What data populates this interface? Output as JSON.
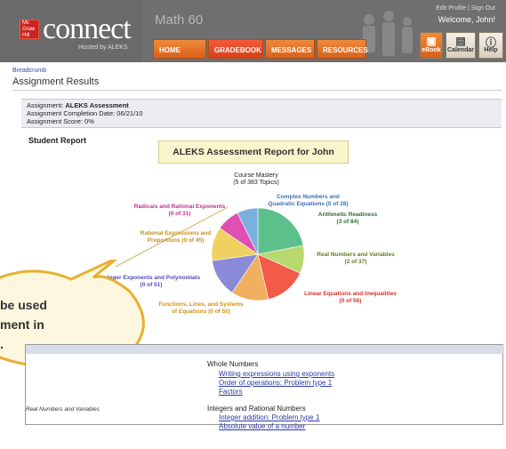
{
  "header": {
    "logo_text": "connect",
    "logo_sub": "Hosted by ALEKS",
    "mh_badge": [
      "Mc",
      "Graw",
      "Hill"
    ],
    "course": "Math 60",
    "top_links": "Edit Profile | Sign Out",
    "welcome": "Welcome, John!",
    "tabs": [
      {
        "label": "HOME"
      },
      {
        "label": "GRADEBOOK"
      },
      {
        "label": "MESSAGES"
      },
      {
        "label": "RESOURCES"
      }
    ],
    "tools": [
      {
        "label": "eBook",
        "icon": "book-icon"
      },
      {
        "label": "Calendar",
        "icon": "calendar-icon"
      },
      {
        "label": "Help",
        "icon": "help-icon"
      }
    ]
  },
  "breadcrumb": "Breadcrumb",
  "page_title": "Assignment Results",
  "assignment": {
    "label": "Assignment:",
    "name": "ALEKS Assessment",
    "completion": "Assignment Completion Date: 06/21/10",
    "score": "Assignment Score: 0%"
  },
  "student_report": "Student Report",
  "report_title": "ALEKS Assessment Report for John",
  "mastery": {
    "line1": "Course Mastery",
    "line2": "(5 of 383 Topics)"
  },
  "chart_data": {
    "type": "pie",
    "title": "Course Mastery",
    "subtitle": "(5 of 383 Topics)",
    "categories": [
      "Arithmetic Readiness",
      "Real Numbers and Variables",
      "Linear Equations and Inequalities",
      "Functions, Lines, and Systems of Equations",
      "Integer Exponents and Polynomials",
      "Rational Expressions and Proportions",
      "Radicals and Rational Exponents",
      "Complex Numbers and Quadratic Equations"
    ],
    "labels": [
      [
        "Arithmetic Readiness",
        "(3 of 84)"
      ],
      [
        "Real Numbers and Variables",
        "(2 of 37)"
      ],
      [
        "Linear Equations and Inequalities",
        "(0 of 56)"
      ],
      [
        "Functions, Lines, and Systems",
        "of Equations (0 of 50)"
      ],
      [
        "Integer Exponents and Polynomials",
        "(0 of 51)"
      ],
      [
        "Rational Expressions and",
        "Proportions (0 of 45)"
      ],
      [
        "Radicals and Rational Exponents",
        "(0 of 31)"
      ],
      [
        "Complex Numbers and",
        "Quadratic Equations (0 of 28)"
      ]
    ],
    "values": [
      84,
      37,
      56,
      50,
      51,
      45,
      31,
      28
    ],
    "mastered": [
      3,
      2,
      0,
      0,
      0,
      0,
      0,
      0
    ],
    "colors": [
      "#5cc08c",
      "#b8d870",
      "#f25a4a",
      "#f0b060",
      "#8a8ad8",
      "#f0d060",
      "#e050b0",
      "#7ab0e0"
    ]
  },
  "callout": {
    "lines": [
      "be used",
      "ment in",
      "."
    ]
  },
  "table": {
    "left_category": "Real Numbers and Variables",
    "groups": [
      {
        "title": "Whole Numbers",
        "links": [
          "Writing expressions using exponents",
          "Order of operations: Problem type 1",
          "Factors"
        ]
      },
      {
        "title": "Integers and Rational Numbers",
        "links": [
          "Integer addition: Problem type 1",
          "Absolute value of a number"
        ]
      }
    ]
  }
}
